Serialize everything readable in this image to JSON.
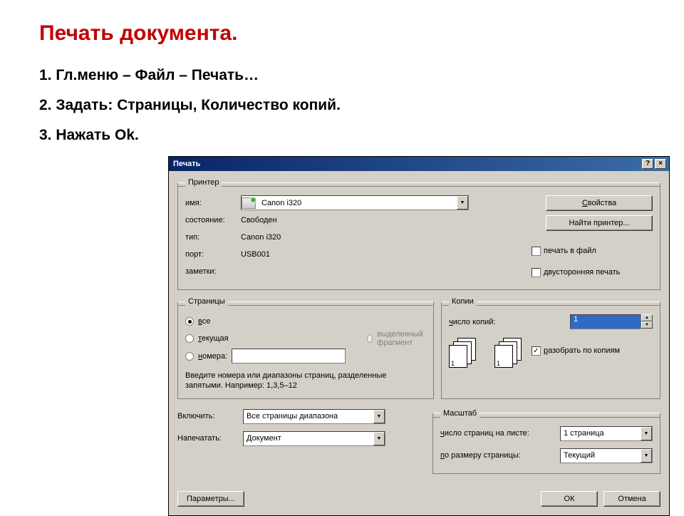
{
  "title": "Печать документа.",
  "steps": {
    "s1": "1. Гл.меню – Файл – Печать…",
    "s2": "2. Задать: Страницы, Количество копий.",
    "s3": "3. Нажать Ok."
  },
  "dialog": {
    "title": "Печать",
    "help_btn": "?",
    "close_btn": "×",
    "printer_group": "Принтер",
    "name_label": "имя:",
    "printer_name": "Canon i320",
    "status_label": "состояние:",
    "status_value": "Свободен",
    "type_label": "тип:",
    "type_value": "Canon i320",
    "port_label": "порт:",
    "port_value": "USB001",
    "notes_label": "заметки:",
    "properties_btn": "Свойства",
    "find_printer_btn": "Найти принтер...",
    "print_to_file": "печать в файл",
    "duplex": "двусторонняя печать",
    "pages_group": "Страницы",
    "pages_all": "все",
    "pages_current": "текущая",
    "pages_numbers": "номера:",
    "pages_selection": "выделенный фрагмент",
    "pages_hint": "Введите номера или диапазоны страниц, разделенные запятыми. Например: 1,3,5–12",
    "copies_group": "Копии",
    "copies_label": "число копий:",
    "copies_value": "1",
    "collate": "разобрать по копиям",
    "include_label": "Включить:",
    "include_value": "Все страницы диапазона",
    "print_what_label": "Напечатать:",
    "print_what_value": "Документ",
    "scale_group": "Масштаб",
    "pages_per_sheet_label": "число страниц на листе:",
    "pages_per_sheet_value": "1 страница",
    "scale_to_label": "по размеру страницы:",
    "scale_to_value": "Текущий",
    "params_btn": "Параметры...",
    "ok_btn": "ОК",
    "cancel_btn": "Отмена"
  }
}
